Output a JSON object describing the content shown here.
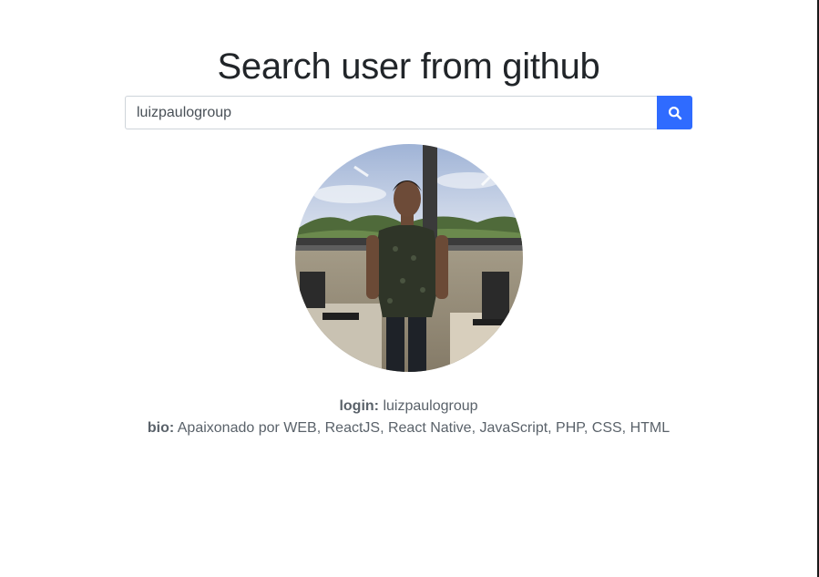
{
  "header": {
    "title": "Search user from github"
  },
  "search": {
    "value": "luizpaulogroup",
    "button_icon": "search-icon",
    "button_color": "#2f6bff"
  },
  "profile": {
    "avatar_icon": "user-avatar-photo",
    "login_label": "login:",
    "login_value": "luizpaulogroup",
    "bio_label": "bio:",
    "bio_value": "Apaixonado por WEB, ReactJS, React Native, JavaScript, PHP, CSS, HTML"
  }
}
